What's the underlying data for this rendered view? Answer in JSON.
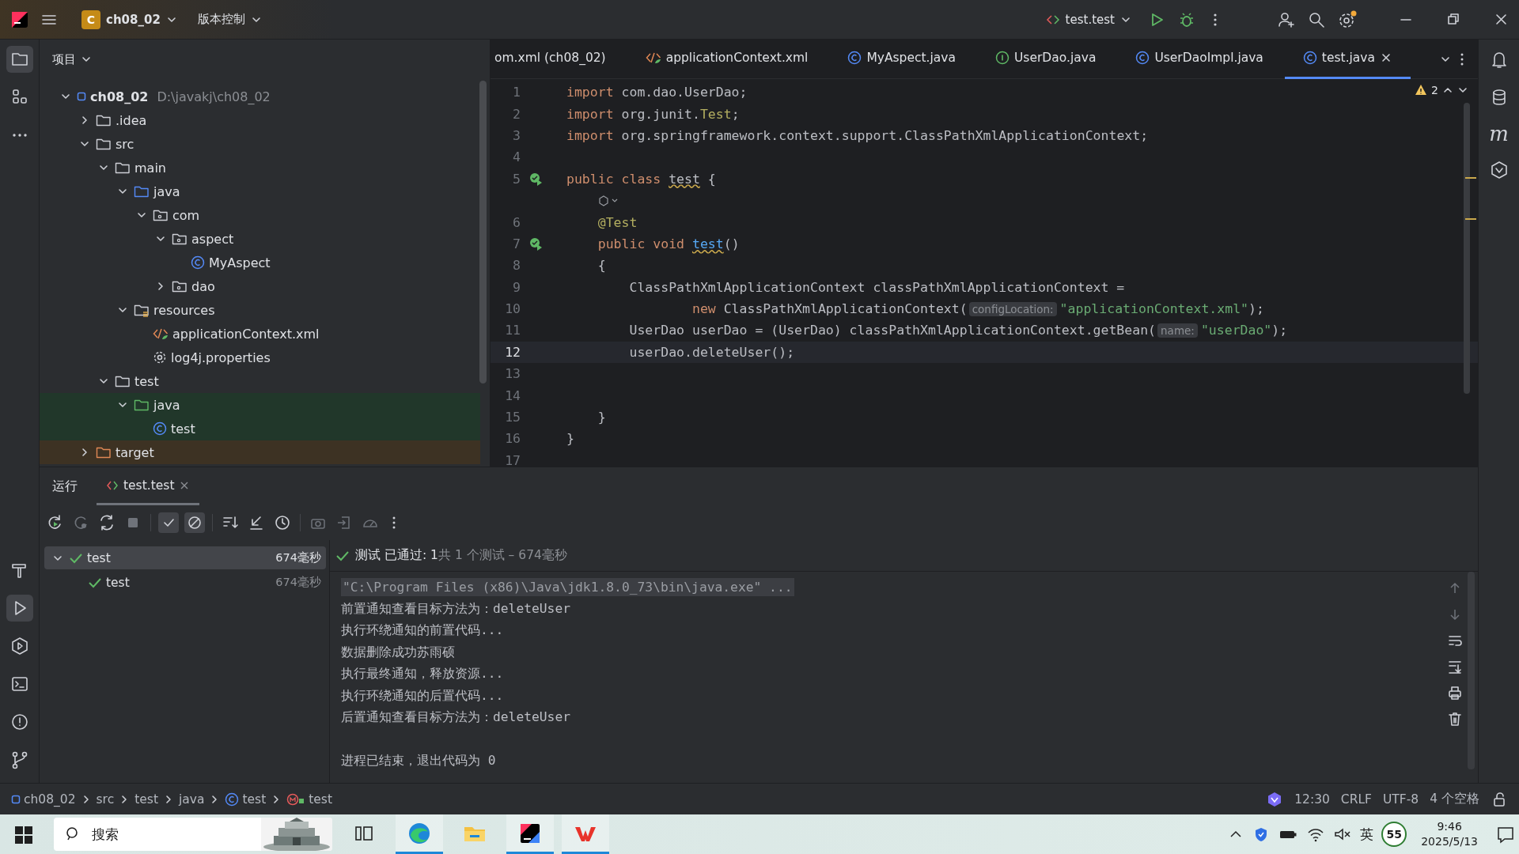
{
  "title_bar": {
    "project_badge": "C",
    "project": "ch08_02",
    "vcs": "版本控制",
    "run_config": "test.test"
  },
  "project_panel": {
    "title": "项目",
    "tree": [
      {
        "label": "ch08_02",
        "path": "D:\\javakj\\ch08_02",
        "kind": "module",
        "expanded": true,
        "children": [
          {
            "label": ".idea",
            "kind": "folder",
            "expanded": false
          },
          {
            "label": "src",
            "kind": "folder",
            "expanded": true,
            "children": [
              {
                "label": "main",
                "kind": "folder",
                "expanded": true,
                "children": [
                  {
                    "label": "java",
                    "kind": "source",
                    "expanded": true,
                    "children": [
                      {
                        "label": "com",
                        "kind": "package",
                        "expanded": true,
                        "children": [
                          {
                            "label": "aspect",
                            "kind": "package",
                            "expanded": true,
                            "children": [
                              {
                                "label": "MyAspect",
                                "kind": "class"
                              }
                            ]
                          },
                          {
                            "label": "dao",
                            "kind": "package",
                            "expanded": false
                          }
                        ]
                      }
                    ]
                  },
                  {
                    "label": "resources",
                    "kind": "resources",
                    "expanded": true,
                    "children": [
                      {
                        "label": "applicationContext.xml",
                        "kind": "xml"
                      },
                      {
                        "label": "log4j.properties",
                        "kind": "properties"
                      }
                    ]
                  }
                ]
              },
              {
                "label": "test",
                "kind": "folder",
                "expanded": true,
                "children": [
                  {
                    "label": "java",
                    "kind": "testsource",
                    "expanded": true,
                    "children": [
                      {
                        "label": "test",
                        "kind": "class",
                        "test_scope": true
                      }
                    ]
                  }
                ]
              }
            ]
          },
          {
            "label": "target",
            "kind": "excluded",
            "expanded": false
          }
        ]
      }
    ]
  },
  "editor": {
    "tabs": [
      {
        "label": "om.xml (ch08_02)",
        "kind": "none",
        "selected": false
      },
      {
        "label": "applicationContext.xml",
        "kind": "xml",
        "selected": false
      },
      {
        "label": "MyAspect.java",
        "kind": "class",
        "selected": false
      },
      {
        "label": "UserDao.java",
        "kind": "interface",
        "selected": false
      },
      {
        "label": "UserDaoImpl.java",
        "kind": "class",
        "selected": false
      },
      {
        "label": "test.java",
        "kind": "class",
        "selected": true
      }
    ],
    "warnings": "2",
    "lines": [
      {
        "number": "1",
        "segments": [
          {
            "text": "import ",
            "kind": "kw"
          },
          {
            "text": "com.dao.UserDao;",
            "kind": "plain"
          }
        ]
      },
      {
        "number": "2",
        "segments": [
          {
            "text": "import ",
            "kind": "kw"
          },
          {
            "text": "org.junit.",
            "kind": "plain"
          },
          {
            "text": "Test",
            "kind": "ann"
          },
          {
            "text": ";",
            "kind": "plain"
          }
        ]
      },
      {
        "number": "3",
        "segments": [
          {
            "text": "import ",
            "kind": "kw"
          },
          {
            "text": "org.springframework.context.support.ClassPathXmlApplicationContext;",
            "kind": "plain"
          }
        ]
      },
      {
        "number": "4"
      },
      {
        "number": "5",
        "runnable": true,
        "segments": [
          {
            "text": "public class ",
            "kind": "kw"
          },
          {
            "text": "test",
            "kind": "warn"
          },
          {
            "text": " {",
            "kind": "plain"
          }
        ]
      },
      {
        "kind": "lens"
      },
      {
        "number": "6",
        "segments": [
          {
            "text": "    @Test",
            "kind": "ann"
          }
        ]
      },
      {
        "number": "7",
        "runnable": true,
        "segments": [
          {
            "text": "    public void ",
            "kind": "kw"
          },
          {
            "text": "test",
            "kind": "fnwarn"
          },
          {
            "text": "()",
            "kind": "plain"
          }
        ]
      },
      {
        "number": "8",
        "segments": [
          {
            "text": "    {",
            "kind": "plain"
          }
        ]
      },
      {
        "number": "9",
        "segments": [
          {
            "text": "        ClassPathXmlApplicationContext classPathXmlApplicationContext =",
            "kind": "plain"
          }
        ]
      },
      {
        "number": "10",
        "segments": [
          {
            "text": "                new ",
            "kind": "kw"
          },
          {
            "text": "ClassPathXmlApplicationContext(",
            "kind": "plain"
          },
          {
            "text": "configLocation:",
            "kind": "hint"
          },
          {
            "text": "\"applicationContext.xml\"",
            "kind": "str"
          },
          {
            "text": ");",
            "kind": "plain"
          }
        ]
      },
      {
        "number": "11",
        "segments": [
          {
            "text": "        UserDao userDao = (UserDao) classPathXmlApplicationContext.getBean(",
            "kind": "plain"
          },
          {
            "text": "name:",
            "kind": "hint"
          },
          {
            "text": "\"userDao\"",
            "kind": "str"
          },
          {
            "text": ");",
            "kind": "plain"
          }
        ]
      },
      {
        "number": "12",
        "current": true,
        "segments": [
          {
            "text": "        userDao.deleteUser();",
            "kind": "plain"
          }
        ]
      },
      {
        "number": "13"
      },
      {
        "number": "14"
      },
      {
        "number": "15",
        "segments": [
          {
            "text": "    }",
            "kind": "plain"
          }
        ]
      },
      {
        "number": "16",
        "segments": [
          {
            "text": "}",
            "kind": "plain"
          }
        ]
      },
      {
        "number": "17"
      }
    ]
  },
  "run_panel": {
    "title": "运行",
    "tabs": [
      {
        "label": "test.test",
        "selected": true
      }
    ],
    "filters": [
      {
        "kind": "passed",
        "selected": true
      },
      {
        "kind": "ignored",
        "selected": true
      }
    ],
    "tests": [
      {
        "label": "test",
        "time": "674毫秒",
        "selected": true,
        "expanded": true,
        "children": [
          {
            "label": "test",
            "time": "674毫秒",
            "selected": false
          }
        ]
      }
    ],
    "summary": {
      "status": "测试 已通过: 1",
      "detail": "共 1 个测试 – 674毫秒"
    },
    "console": [
      {
        "text": "\"C:\\Program Files (x86)\\Java\\jdk1.8.0_73\\bin\\java.exe\" ...",
        "kind": "command"
      },
      {
        "text": "前置通知查看目标方法为：deleteUser",
        "kind": "out"
      },
      {
        "text": "执行环绕通知的前置代码...",
        "kind": "out"
      },
      {
        "text": "数据删除成功苏雨硕",
        "kind": "out"
      },
      {
        "text": "执行最终通知，释放资源...",
        "kind": "out"
      },
      {
        "text": "执行环绕通知的后置代码...",
        "kind": "out"
      },
      {
        "text": "后置通知查看目标方法为：deleteUser",
        "kind": "out"
      },
      {
        "kind": "blank"
      },
      {
        "text": "进程已结束，退出代码为 0",
        "kind": "out"
      }
    ]
  },
  "right_strip": {
    "maven_label": "m"
  },
  "status_bar": {
    "breadcrumbs": [
      {
        "label": "ch08_02",
        "kind": "module"
      },
      {
        "label": "src",
        "kind": "none"
      },
      {
        "label": "test",
        "kind": "none"
      },
      {
        "label": "java",
        "kind": "none"
      },
      {
        "label": "test",
        "kind": "class"
      },
      {
        "label": "test",
        "kind": "method"
      }
    ],
    "position": "12:30",
    "line_ending": "CRLF",
    "encoding": "UTF-8",
    "indent": "4 个空格"
  },
  "taskbar": {
    "search": {
      "placeholder": "搜索"
    },
    "apps": [
      {
        "kind": "taskview",
        "running": false
      },
      {
        "kind": "browser",
        "running": true
      },
      {
        "kind": "files",
        "running": false
      },
      {
        "kind": "ide",
        "running": true
      },
      {
        "kind": "office",
        "running": true
      }
    ],
    "ime": "英",
    "badge": "55",
    "time": "9:46",
    "date": "2025/5/13"
  }
}
